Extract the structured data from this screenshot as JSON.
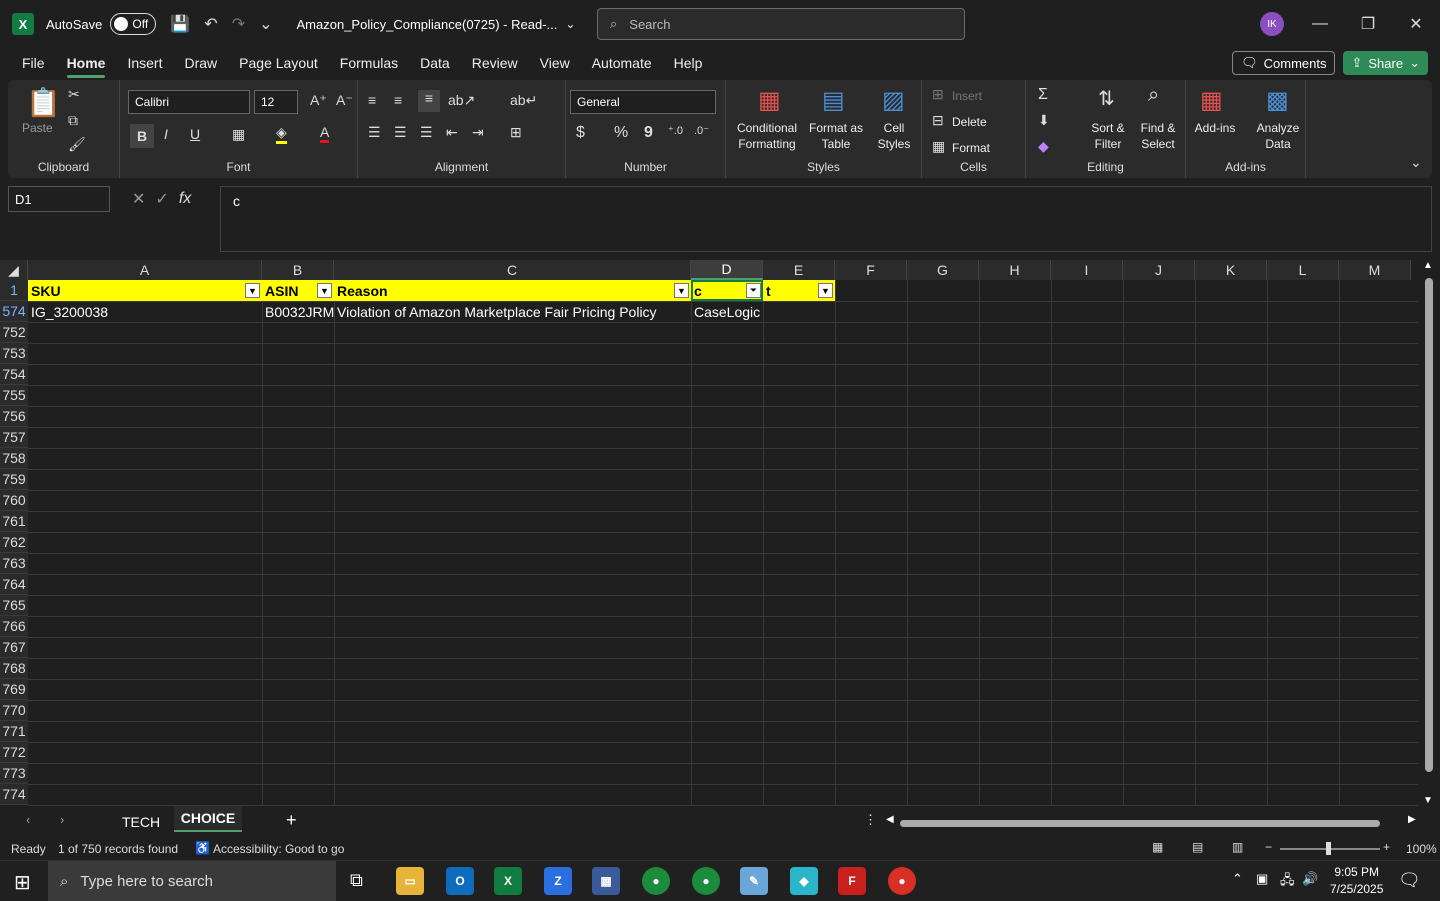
{
  "titlebar": {
    "app_icon": "excel-icon",
    "autosave_label": "AutoSave",
    "autosave_state": "Off",
    "doc_title": "Amazon_Policy_Compliance(0725)  -  Read-...",
    "search_placeholder": "Search",
    "avatar_initials": "IK"
  },
  "menu": {
    "items": [
      "File",
      "Home",
      "Insert",
      "Draw",
      "Page Layout",
      "Formulas",
      "Data",
      "Review",
      "View",
      "Automate",
      "Help"
    ],
    "active": "Home",
    "comments": "Comments",
    "share": "Share"
  },
  "ribbon": {
    "clipboard": {
      "paste": "Paste",
      "label": "Clipboard"
    },
    "font": {
      "family": "Calibri",
      "size": "12",
      "label": "Font",
      "bold": "B",
      "italic": "I",
      "underline": "U"
    },
    "alignment": {
      "label": "Alignment"
    },
    "number": {
      "format": "General",
      "label": "Number",
      "currency": "$",
      "percent": "%",
      "comma": "9"
    },
    "styles": {
      "conditional": "Conditional Formatting",
      "format_table": "Format as Table",
      "cell_styles": "Cell Styles",
      "label": "Styles"
    },
    "cells": {
      "insert": "Insert",
      "delete": "Delete",
      "format": "Format",
      "label": "Cells"
    },
    "editing": {
      "sort": "Sort & Filter",
      "find": "Find & Select",
      "label": "Editing"
    },
    "addins": {
      "addins": "Add-ins",
      "analyze": "Analyze Data",
      "label": "Add-ins"
    }
  },
  "formula": {
    "namebox": "D1",
    "value": "c"
  },
  "sheet": {
    "columns": [
      "A",
      "B",
      "C",
      "D",
      "E",
      "F",
      "G",
      "H",
      "I",
      "J",
      "K",
      "L",
      "M"
    ],
    "selected_column": "D",
    "header_row": {
      "num": "1",
      "cells": [
        "SKU",
        "ASIN",
        "Reason",
        "c",
        "t"
      ]
    },
    "data_row": {
      "num": "574",
      "cells": [
        "IG_3200038",
        "B0032JRM",
        "Violation of Amazon Marketplace Fair Pricing Policy",
        "CaseLogic"
      ]
    },
    "row_numbers": [
      "752",
      "753",
      "754",
      "755",
      "756",
      "757",
      "758",
      "759",
      "760",
      "761",
      "762",
      "763",
      "764",
      "765",
      "766",
      "767",
      "768",
      "769",
      "770",
      "771",
      "772",
      "773",
      "774"
    ]
  },
  "tabs": {
    "items": [
      "TECH",
      "CHOICE"
    ],
    "active": "CHOICE"
  },
  "status": {
    "ready": "Ready",
    "records": "1 of 750 records found",
    "accessibility": "Accessibility: Good to go",
    "zoom": "100%"
  },
  "taskbar": {
    "search_placeholder": "Type here to search",
    "time": "9:05 PM",
    "date": "7/25/2025"
  }
}
